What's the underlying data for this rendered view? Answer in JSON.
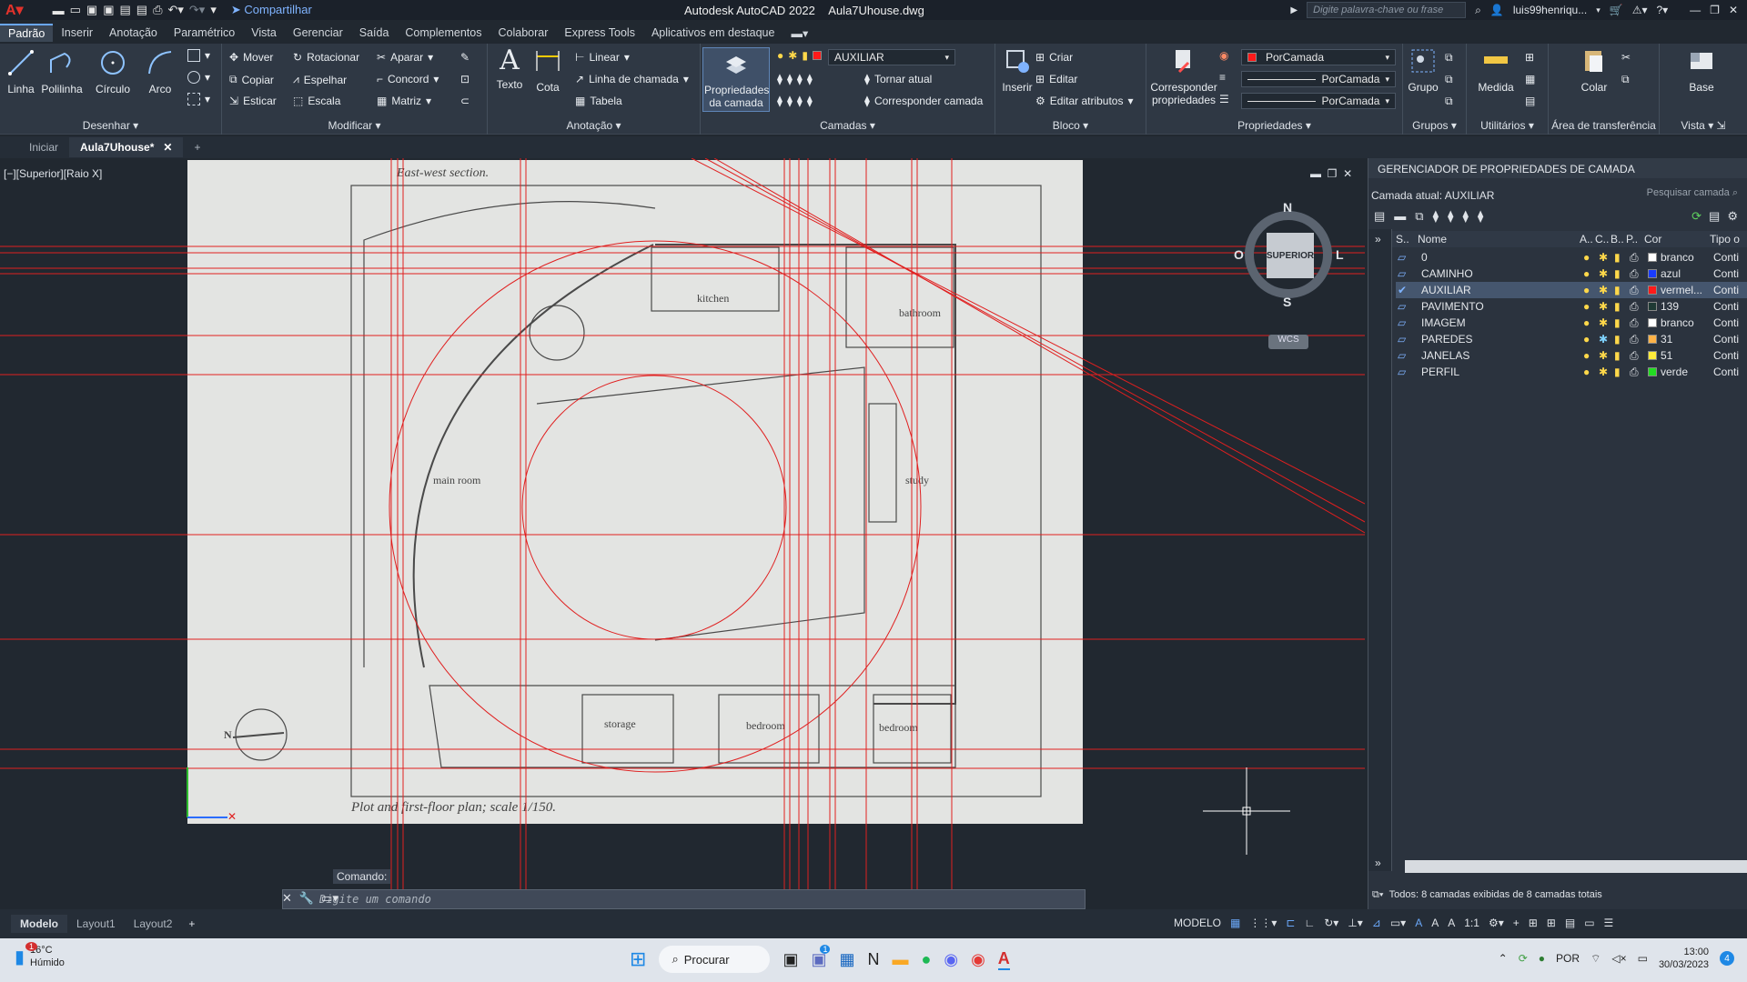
{
  "app": {
    "title": "Autodesk AutoCAD 2022",
    "filename": "Aula7Uhouse.dwg",
    "share_label": "Compartilhar",
    "search_placeholder": "Digite palavra-chave ou frase",
    "user": "luis99henriqu..."
  },
  "menu_tabs": [
    "Padrão",
    "Inserir",
    "Anotação",
    "Paramétrico",
    "Vista",
    "Gerenciar",
    "Saída",
    "Complementos",
    "Colaborar",
    "Express Tools",
    "Aplicativos em destaque"
  ],
  "ribbon": {
    "desenhar": {
      "title": "Desenhar",
      "linha": "Linha",
      "polilinha": "Polilinha",
      "circulo": "Círculo",
      "arco": "Arco"
    },
    "modificar": {
      "title": "Modificar",
      "mover": "Mover",
      "rotacionar": "Rotacionar",
      "aparar": "Aparar",
      "copiar": "Copiar",
      "espelhar": "Espelhar",
      "concord": "Concord",
      "esticar": "Esticar",
      "escala": "Escala",
      "matriz": "Matriz"
    },
    "anotacao": {
      "title": "Anotação",
      "texto": "Texto",
      "cota": "Cota",
      "linear": "Linear",
      "linha_chamada": "Linha de chamada",
      "tabela": "Tabela"
    },
    "camadas": {
      "title": "Camadas",
      "props": "Propriedades da camada",
      "current_layer": "AUXILIAR",
      "tornar_atual": "Tornar atual",
      "corresponder": "Corresponder camada"
    },
    "bloco": {
      "title": "Bloco",
      "inserir": "Inserir",
      "criar": "Criar",
      "editar": "Editar",
      "editar_atributos": "Editar atributos"
    },
    "propriedades": {
      "title": "Propriedades",
      "corresponder": "Corresponder propriedades",
      "cor": "PorCamada",
      "linha1": "PorCamada",
      "linha2": "PorCamada"
    },
    "grupos": {
      "title": "Grupos",
      "grupo": "Grupo"
    },
    "utilitarios": {
      "title": "Utilitários",
      "medida": "Medida"
    },
    "transferencia": {
      "title": "Área de transferência",
      "colar": "Colar"
    },
    "vista": {
      "title": "Vista",
      "base": "Base"
    }
  },
  "doc_tabs": {
    "start": "Iniciar",
    "active": "Aula7Uhouse*"
  },
  "viewport": {
    "label": "[−][Superior][Raio X]",
    "viewcube": {
      "n": "N",
      "s": "S",
      "o": "O",
      "l": "L",
      "face": "SUPERIOR",
      "wcs": "WCS"
    },
    "drawing_texts": {
      "top": "East-west section.",
      "bottom_caption": "Plot and first-floor plan; scale   1/150.",
      "kitchen": "kitchen",
      "bathroom": "bathroom",
      "main_room": "main room",
      "study": "study",
      "storage": "storage",
      "bedroom1": "bedroom",
      "bedroom2": "bedroom",
      "north": "N"
    }
  },
  "layer_panel": {
    "title": "GERENCIADOR DE PROPRIEDADES DE CAMADA",
    "current": "Camada atual: AUXILIAR",
    "search": "Pesquisar camada",
    "columns": {
      "s": "S..",
      "name": "Nome",
      "a": "A..",
      "c": "C..",
      "b": "B..",
      "p": "P..",
      "color": "Cor",
      "type": "Tipo o"
    },
    "layers": [
      {
        "name": "0",
        "color_name": "branco",
        "swatch": "#ffffff",
        "type": "Conti"
      },
      {
        "name": "CAMINHO",
        "color_name": "azul",
        "swatch": "#1a3cff",
        "type": "Conti"
      },
      {
        "name": "AUXILIAR",
        "color_name": "vermel...",
        "swatch": "#ff1a1a",
        "type": "Conti"
      },
      {
        "name": "PAVIMENTO",
        "color_name": "139",
        "swatch": "#1f3a34",
        "type": "Conti"
      },
      {
        "name": "IMAGEM",
        "color_name": "branco",
        "swatch": "#ffffff",
        "type": "Conti"
      },
      {
        "name": "PAREDES",
        "color_name": "31",
        "swatch": "#ffb347",
        "type": "Conti"
      },
      {
        "name": "JANELAS",
        "color_name": "51",
        "swatch": "#ffeb3b",
        "type": "Conti"
      },
      {
        "name": "PERFIL",
        "color_name": "verde",
        "swatch": "#22dd22",
        "type": "Conti"
      }
    ],
    "footer": "Todos: 8 camadas exibidas de 8 camadas totais"
  },
  "command": {
    "label": "Comando:",
    "placeholder": "Digite um comando"
  },
  "status": {
    "tabs": [
      "Modelo",
      "Layout1",
      "Layout2"
    ],
    "mode": "MODELO",
    "scale": "1:1"
  },
  "taskbar": {
    "weather_temp": "16°C",
    "weather_desc": "Húmido",
    "weather_badge": "1",
    "search": "Procurar",
    "lang": "POR",
    "time": "13:00",
    "date": "30/03/2023",
    "notif": "4",
    "teams_badge": "1"
  }
}
